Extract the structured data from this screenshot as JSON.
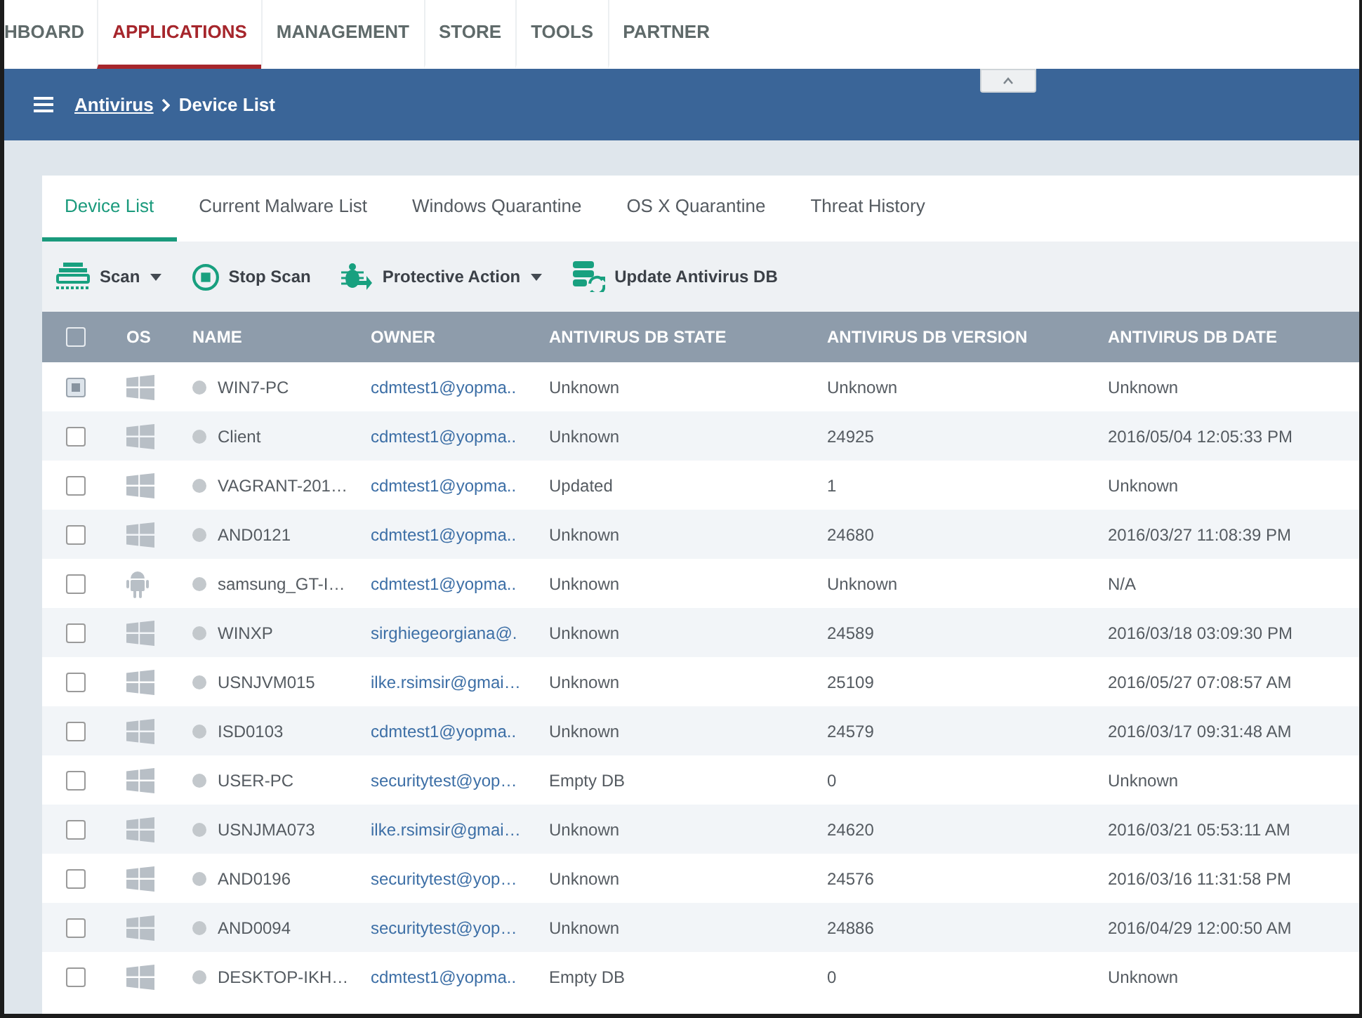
{
  "top_nav": {
    "items": [
      {
        "label": "HBOARD",
        "selected": false
      },
      {
        "label": "APPLICATIONS",
        "selected": true
      },
      {
        "label": "MANAGEMENT",
        "selected": false
      },
      {
        "label": "STORE",
        "selected": false
      },
      {
        "label": "TOOLS",
        "selected": false
      },
      {
        "label": "PARTNER",
        "selected": false
      }
    ]
  },
  "header_bar": {
    "breadcrumb_link": "Antivirus",
    "breadcrumb_current": "Device List"
  },
  "tabs": [
    {
      "label": "Device List",
      "selected": true
    },
    {
      "label": "Current Malware List",
      "selected": false
    },
    {
      "label": "Windows Quarantine",
      "selected": false
    },
    {
      "label": "OS X Quarantine",
      "selected": false
    },
    {
      "label": "Threat History",
      "selected": false
    }
  ],
  "toolbar": [
    {
      "label": "Scan",
      "dropdown": true
    },
    {
      "label": "Stop Scan",
      "dropdown": false
    },
    {
      "label": "Protective Action",
      "dropdown": true
    },
    {
      "label": "Update Antivirus DB",
      "dropdown": false
    }
  ],
  "table": {
    "select_all_checked": false,
    "columns": [
      "OS",
      "NAME",
      "OWNER",
      "ANTIVIRUS DB STATE",
      "ANTIVIRUS DB VERSION",
      "ANTIVIRUS DB DATE"
    ],
    "rows": [
      {
        "checked": true,
        "kind": "windows",
        "name": "WIN7-PC",
        "owner": "cdmtest1@yopma..",
        "state": "Unknown",
        "version": "Unknown",
        "date": "Unknown"
      },
      {
        "checked": false,
        "kind": "windows",
        "name": "Client",
        "owner": "cdmtest1@yopma..",
        "state": "Unknown",
        "version": "24925",
        "date": "2016/05/04 12:05:33 PM"
      },
      {
        "checked": false,
        "kind": "windows",
        "name": "VAGRANT-201…",
        "owner": "cdmtest1@yopma..",
        "state": "Updated",
        "version": "1",
        "date": "Unknown"
      },
      {
        "checked": false,
        "kind": "windows",
        "name": "AND0121",
        "owner": "cdmtest1@yopma..",
        "state": "Unknown",
        "version": "24680",
        "date": "2016/03/27 11:08:39 PM"
      },
      {
        "checked": false,
        "kind": "android",
        "name": "samsung_GT-I…",
        "owner": "cdmtest1@yopma..",
        "state": "Unknown",
        "version": "Unknown",
        "date": "N/A"
      },
      {
        "checked": false,
        "kind": "windows",
        "name": "WINXP",
        "owner": "sirghiegeorgiana@.",
        "state": "Unknown",
        "version": "24589",
        "date": "2016/03/18 03:09:30 PM"
      },
      {
        "checked": false,
        "kind": "windows",
        "name": "USNJVM015",
        "owner": "ilke.rsimsir@gmai…",
        "state": "Unknown",
        "version": "25109",
        "date": "2016/05/27 07:08:57 AM"
      },
      {
        "checked": false,
        "kind": "windows",
        "name": "ISD0103",
        "owner": "cdmtest1@yopma..",
        "state": "Unknown",
        "version": "24579",
        "date": "2016/03/17 09:31:48 AM"
      },
      {
        "checked": false,
        "kind": "windows",
        "name": "USER-PC",
        "owner": "securitytest@yop…",
        "state": "Empty DB",
        "version": "0",
        "date": "Unknown"
      },
      {
        "checked": false,
        "kind": "windows",
        "name": "USNJMA073",
        "owner": "ilke.rsimsir@gmai…",
        "state": "Unknown",
        "version": "24620",
        "date": "2016/03/21 05:53:11 AM"
      },
      {
        "checked": false,
        "kind": "windows",
        "name": "AND0196",
        "owner": "securitytest@yop…",
        "state": "Unknown",
        "version": "24576",
        "date": "2016/03/16 11:31:58 PM"
      },
      {
        "checked": false,
        "kind": "windows",
        "name": "AND0094",
        "owner": "securitytest@yop…",
        "state": "Unknown",
        "version": "24886",
        "date": "2016/04/29 12:00:50 AM"
      },
      {
        "checked": false,
        "kind": "windows",
        "name": "DESKTOP-IKH…",
        "owner": "cdmtest1@yopma..",
        "state": "Empty DB",
        "version": "0",
        "date": "Unknown"
      }
    ]
  }
}
